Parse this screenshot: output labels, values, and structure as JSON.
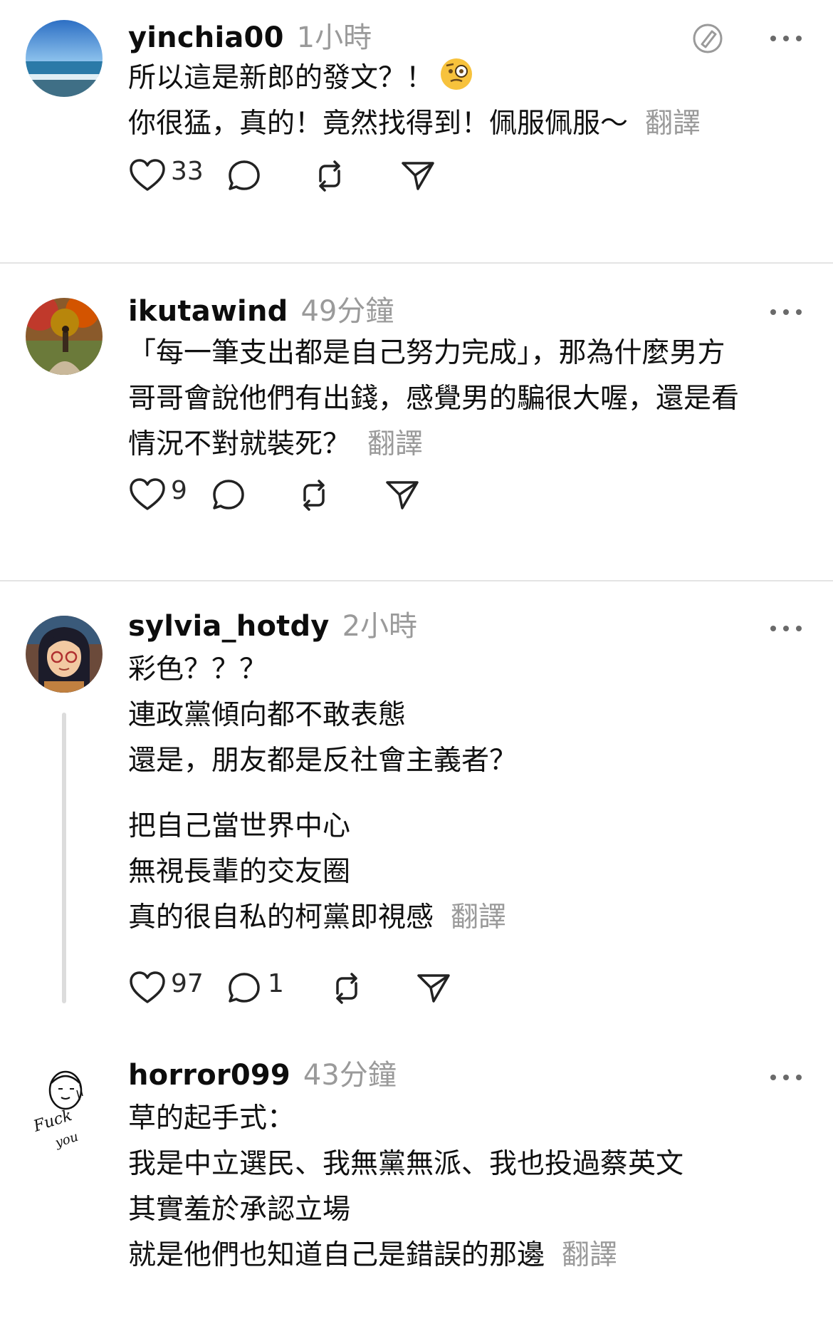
{
  "posts": [
    {
      "username": "yinchia00",
      "time": "1小時",
      "lines": [
        "所以這是新郎的發文？！",
        "你很猛，真的！竟然找得到！佩服佩服～"
      ],
      "translate": "翻譯",
      "likes": "33",
      "replies": "",
      "avatar": "beach-photo",
      "emoji": "monocle-face"
    },
    {
      "username": "ikutawind",
      "time": "49分鐘",
      "lines": [
        "「每一筆支出都是自己努力完成」，那為什麼男方",
        "哥哥會說他們有出錢，感覺男的騙很大喔，還是看",
        "情況不對就裝死？"
      ],
      "translate": "翻譯",
      "likes": "9",
      "replies": "",
      "avatar": "autumn-photo"
    },
    {
      "username": "sylvia_hotdy",
      "time": "2小時",
      "lines": [
        "彩色？？？",
        "連政黨傾向都不敢表態",
        "還是，朋友都是反社會主義者？"
      ],
      "lines2": [
        "把自己當世界中心",
        "無視長輩的交友圈",
        "真的很自私的柯黨即視感"
      ],
      "translate": "翻譯",
      "likes": "97",
      "replies": "1",
      "avatar": "cartoon-girl-avatar"
    },
    {
      "username": "horror099",
      "time": "43分鐘",
      "lines": [
        "草的起手式：",
        "我是中立選民、我無黨無派、我也投過蔡英文",
        "其實羞於承認立場",
        "就是他們也知道自己是錯誤的那邊"
      ],
      "translate": "翻譯",
      "avatar": "sketch-face-avatar",
      "avatar_text": "Fuck you"
    }
  ],
  "colors": {
    "muted": "#9a9a9a",
    "divider": "#e4e4e4",
    "text": "#101010"
  }
}
